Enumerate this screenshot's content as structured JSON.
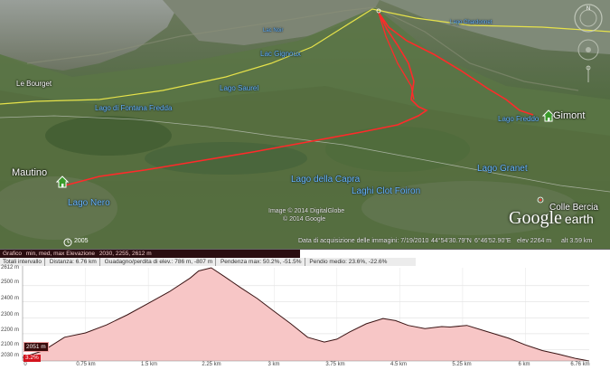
{
  "map": {
    "place_labels": [
      {
        "id": "mautino",
        "text": "Mautino"
      },
      {
        "id": "gimont",
        "text": "Gimont"
      },
      {
        "id": "colle-bercia",
        "text": "Colle Bercia"
      },
      {
        "id": "le-bourget",
        "text": "Le Bourget"
      }
    ],
    "lake_labels": [
      {
        "id": "lago-nero",
        "text": "Lago Nero"
      },
      {
        "id": "lago-della-capra",
        "text": "Lago della Capra"
      },
      {
        "id": "laghi-clot-foiron",
        "text": "Laghi Clot Foiron"
      },
      {
        "id": "lago-granet",
        "text": "Lago Granet"
      },
      {
        "id": "lago-di-fontana-fredda",
        "text": "Lago di Fontana Fredda"
      },
      {
        "id": "lago-saurel",
        "text": "Lago Saurel"
      },
      {
        "id": "lac-gignoux",
        "text": "Lac Gignoux"
      },
      {
        "id": "lac-noir",
        "text": "Lac Noir"
      },
      {
        "id": "lago-freddo",
        "text": "Lago Freddo"
      },
      {
        "id": "lago-chardonnet",
        "text": "Lago Chardonnet"
      }
    ],
    "copyright": [
      "Image © 2014 DigitalGlobe",
      "© 2014 Google"
    ],
    "scale_year": "2005",
    "logo": {
      "google": "Google",
      "earth": "earth"
    },
    "status": {
      "date": "Data di acquisizione delle immagini: 7/19/2010",
      "lat": "44°54'30.79\"N",
      "lon": "6°46'52.90\"E",
      "elev": "elev 2264 m",
      "alt": "alt 3.59 km"
    }
  },
  "profile": {
    "stats_row1": {
      "label": "Grafico",
      "min_mean_max": "min, med, max Elevazione",
      "values": "2030, 2255, 2612 m"
    },
    "stats_row2": [
      "Totali intervallo",
      "Distanza: 6.76 km",
      "Guadagno/perdita di elev.: 786 m, -807 m",
      "Pendenza max: 50.2%, -51.5%",
      "Pendio medio: 23.6%, -22.6%"
    ],
    "y_ticks": [
      "2612 m",
      "2500 m",
      "2400 m",
      "2300 m",
      "2200 m",
      "2100 m",
      "2030 m"
    ],
    "x_ticks": [
      "0",
      "0.75 km",
      "1.5 km",
      "2.25 km",
      "3 km",
      "3.75 km",
      "4.5 km",
      "5.25 km",
      "6 km",
      "6.76 km"
    ],
    "current_elev_tag": "2051 m",
    "current_slope_tag": "3.2%",
    "fill_color": "#f7c6c6",
    "line_color": "#3a1414"
  },
  "chart_data": {
    "type": "area",
    "x": [
      0,
      0.25,
      0.5,
      0.75,
      1.0,
      1.25,
      1.5,
      1.75,
      2.0,
      2.1,
      2.25,
      2.4,
      2.6,
      2.8,
      3.0,
      3.2,
      3.4,
      3.6,
      3.75,
      3.9,
      4.1,
      4.3,
      4.45,
      4.6,
      4.8,
      5.0,
      5.1,
      5.3,
      5.5,
      5.8,
      6.0,
      6.2,
      6.4,
      6.6,
      6.76
    ],
    "y": [
      2052,
      2095,
      2178,
      2205,
      2255,
      2318,
      2390,
      2462,
      2548,
      2592,
      2612,
      2560,
      2488,
      2420,
      2340,
      2262,
      2178,
      2148,
      2166,
      2210,
      2262,
      2295,
      2282,
      2252,
      2232,
      2245,
      2242,
      2252,
      2220,
      2172,
      2130,
      2095,
      2072,
      2045,
      2030
    ],
    "xlabel": "",
    "ylabel": "",
    "xlim": [
      0,
      6.76
    ],
    "ylim": [
      2030,
      2612
    ],
    "grid": true
  }
}
